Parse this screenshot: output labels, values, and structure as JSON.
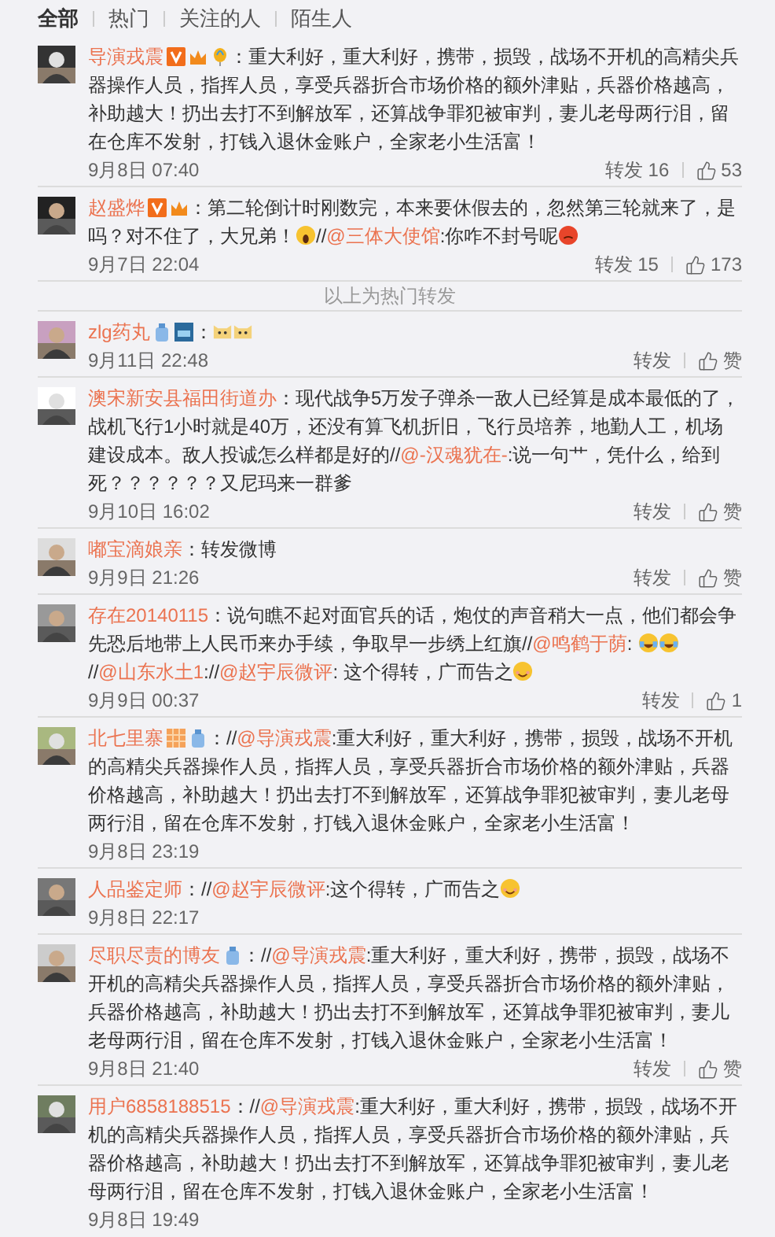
{
  "tabs": [
    {
      "label": "全部",
      "selected": true
    },
    {
      "label": "热门",
      "selected": false
    },
    {
      "label": "关注的人",
      "selected": false
    },
    {
      "label": "陌生人",
      "selected": false
    }
  ],
  "hot_comments": [
    {
      "name": "导演戎震",
      "badges": [
        {
          "kind": "verified"
        },
        {
          "kind": "crown"
        },
        {
          "kind": "balloon"
        }
      ],
      "segments": [
        {
          "kind": "text",
          "text": "：重大利好，重大利好，携带，损毁，战场不开机的高精尖兵器操作人员，指挥人员，享受兵器折合市场价格的额外津贴，兵器价格越高，补助越大！扔出去打不到解放军，还算战争罪犯被审判，妻儿老母两行泪，留在仓库不发射，打钱入退休金账户，全家老小生活富！"
        }
      ],
      "time": "9月8日 07:40",
      "repost": "转发 16",
      "like": "53"
    },
    {
      "name": "赵盛烨",
      "badges": [
        {
          "kind": "verified"
        },
        {
          "kind": "crown"
        }
      ],
      "segments": [
        {
          "kind": "text",
          "text": "：第二轮倒计时刚数完，本来要休假去的，忽然第三轮就来了，是吗？对不住了，大兄弟！"
        },
        {
          "kind": "shock"
        },
        {
          "kind": "text",
          "text": "//"
        },
        {
          "kind": "mention",
          "text": "@三体大使馆"
        },
        {
          "kind": "text",
          "text": ":你咋不封号呢"
        },
        {
          "kind": "angry"
        }
      ],
      "time": "9月7日 22:04",
      "repost": "转发 15",
      "like": "173"
    }
  ],
  "divider": "以上为热门转发",
  "comments": [
    {
      "name": "zlg药丸",
      "badges": [
        {
          "kind": "member"
        },
        {
          "kind": "level"
        }
      ],
      "segments": [
        {
          "kind": "text",
          "text": "："
        },
        {
          "kind": "cat"
        },
        {
          "kind": "cat"
        }
      ],
      "time": "9月11日 22:48",
      "repost": "转发",
      "like": "赞"
    },
    {
      "name": "澳宋新安县福田街道办",
      "segments": [
        {
          "kind": "text",
          "text": "：现代战争5万发子弹杀一敌人已经算是成本最低的了，战机飞行1小时就是40万，还没有算飞机折旧，飞行员培养，地勤人工，机场建设成本。敌人投诚怎么样都是好的//"
        },
        {
          "kind": "mention",
          "text": "@-汉魂犹在-"
        },
        {
          "kind": "text",
          "text": ":说一句艹，凭什么，给到死？？？？？？又尼玛来一群爹"
        }
      ],
      "time": "9月10日 16:02",
      "repost": "转发",
      "like": "赞"
    },
    {
      "name": "嘟宝滴娘亲",
      "segments": [
        {
          "kind": "text",
          "text": "：转发微博"
        }
      ],
      "time": "9月9日 21:26",
      "repost": "转发",
      "like": "赞"
    },
    {
      "name": "存在20140115",
      "segments": [
        {
          "kind": "text",
          "text": "：说句瞧不起对面官兵的话，炮仗的声音稍大一点，他们都会争先恐后地带上人民币来办手续，争取早一步绣上红旗//"
        },
        {
          "kind": "mention",
          "text": "@鸣鹤于荫"
        },
        {
          "kind": "text",
          "text": ": "
        },
        {
          "kind": "laugh"
        },
        {
          "kind": "laugh"
        },
        {
          "kind": "text",
          "text": "//"
        },
        {
          "kind": "mention",
          "text": "@山东水土1"
        },
        {
          "kind": "text",
          "text": "://"
        },
        {
          "kind": "mention",
          "text": "@赵宇辰微评"
        },
        {
          "kind": "text",
          "text": ": 这个得转，广而告之"
        },
        {
          "kind": "smile"
        }
      ],
      "time": "9月9日 00:37",
      "repost": "转发",
      "like": "1"
    },
    {
      "name": "北七里寨",
      "badges": [
        {
          "kind": "vip"
        },
        {
          "kind": "member"
        }
      ],
      "segments": [
        {
          "kind": "text",
          "text": "：//"
        },
        {
          "kind": "mention",
          "text": "@导演戎震"
        },
        {
          "kind": "text",
          "text": ":重大利好，重大利好，携带，损毁，战场不开机的高精尖兵器操作人员，指挥人员，享受兵器折合市场价格的额外津贴，兵器价格越高，补助越大！扔出去打不到解放军，还算战争罪犯被审判，妻儿老母两行泪，留在仓库不发射，打钱入退休金账户，全家老小生活富！"
        }
      ],
      "time": "9月8日 23:19"
    },
    {
      "name": "人品鉴定师",
      "segments": [
        {
          "kind": "text",
          "text": "：//"
        },
        {
          "kind": "mention",
          "text": "@赵宇辰微评"
        },
        {
          "kind": "text",
          "text": ":这个得转，广而告之"
        },
        {
          "kind": "smile"
        }
      ],
      "time": "9月8日 22:17"
    },
    {
      "name": "尽职尽责的博友",
      "badges": [
        {
          "kind": "member"
        }
      ],
      "segments": [
        {
          "kind": "text",
          "text": "：//"
        },
        {
          "kind": "mention",
          "text": "@导演戎震"
        },
        {
          "kind": "text",
          "text": ":重大利好，重大利好，携带，损毁，战场不开机的高精尖兵器操作人员，指挥人员，享受兵器折合市场价格的额外津贴，兵器价格越高，补助越大！扔出去打不到解放军，还算战争罪犯被审判，妻儿老母两行泪，留在仓库不发射，打钱入退休金账户，全家老小生活富！"
        }
      ],
      "time": "9月8日 21:40",
      "repost": "转发",
      "like": "赞"
    },
    {
      "name": "用户6858188515",
      "segments": [
        {
          "kind": "text",
          "text": "：//"
        },
        {
          "kind": "mention",
          "text": "@导演戎震"
        },
        {
          "kind": "text",
          "text": ":重大利好，重大利好，携带，损毁，战场不开机的高精尖兵器操作人员，指挥人员，享受兵器折合市场价格的额外津贴，兵器价格越高，补助越大！扔出去打不到解放军，还算战争罪犯被审判，妻儿老母两行泪，留在仓库不发射，打钱入退休金账户，全家老小生活富！"
        }
      ],
      "time": "9月8日 19:49"
    }
  ]
}
